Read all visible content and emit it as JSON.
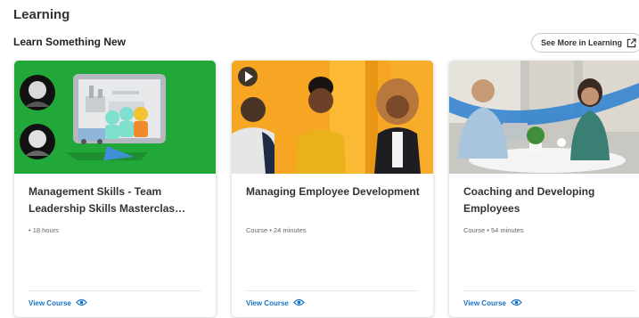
{
  "section_title": "Learning",
  "subsection_title": "Learn Something New",
  "see_more_label": "See More in Learning",
  "accent_color": "#1a73c8",
  "courses": [
    {
      "title": "Management Skills - Team Leadership Skills Masterclas…",
      "meta": "• 18 hours",
      "action_label": "View Course",
      "thumbnail": "green illustration with two portraits"
    },
    {
      "title": "Managing Employee Development",
      "meta": "Course • 24 minutes",
      "action_label": "View Course",
      "thumbnail": "yellow background with three people, play icon"
    },
    {
      "title": "Coaching and Developing Employees",
      "meta": "Course • 54 minutes",
      "action_label": "View Course",
      "thumbnail": "office meeting photo"
    }
  ]
}
